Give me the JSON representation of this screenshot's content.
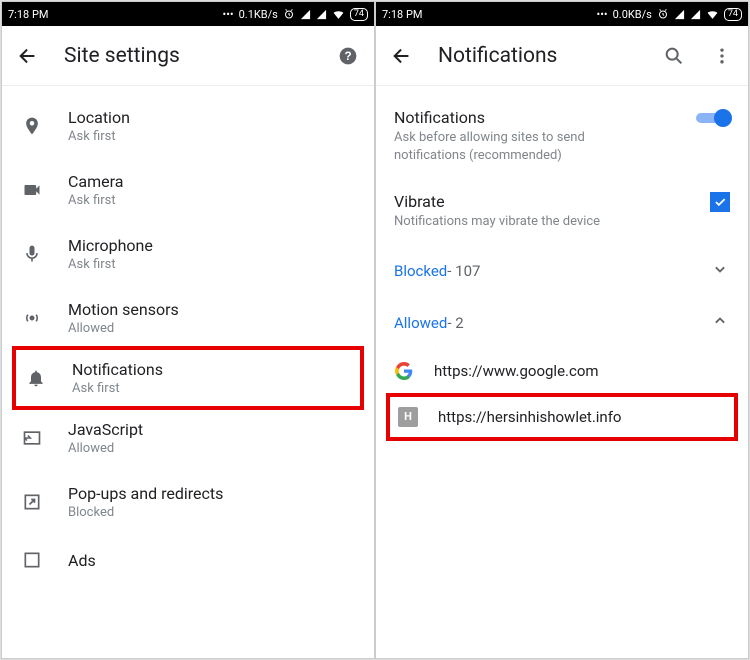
{
  "status": {
    "time": "7:18 PM",
    "speed_left": "0.1KB/s",
    "speed_right": "0.0KB/s",
    "battery": "74"
  },
  "left": {
    "title": "Site settings",
    "items": [
      {
        "label": "Location",
        "sub": "Ask first"
      },
      {
        "label": "Camera",
        "sub": "Ask first"
      },
      {
        "label": "Microphone",
        "sub": "Ask first"
      },
      {
        "label": "Motion sensors",
        "sub": "Allowed"
      },
      {
        "label": "Notifications",
        "sub": "Ask first"
      },
      {
        "label": "JavaScript",
        "sub": "Allowed"
      },
      {
        "label": "Pop-ups and redirects",
        "sub": "Blocked"
      },
      {
        "label": "Ads",
        "sub": ""
      }
    ]
  },
  "right": {
    "title": "Notifications",
    "notif_title": "Notifications",
    "notif_desc": "Ask before allowing sites to send notifications (recommended)",
    "vibrate_title": "Vibrate",
    "vibrate_desc": "Notifications may vibrate the device",
    "blocked_label": "Blocked",
    "blocked_count": " - 107",
    "allowed_label": "Allowed",
    "allowed_count": " - 2",
    "sites": [
      {
        "url": "https://www.google.com"
      },
      {
        "url": "https://hersinhishowlet.info"
      }
    ]
  }
}
